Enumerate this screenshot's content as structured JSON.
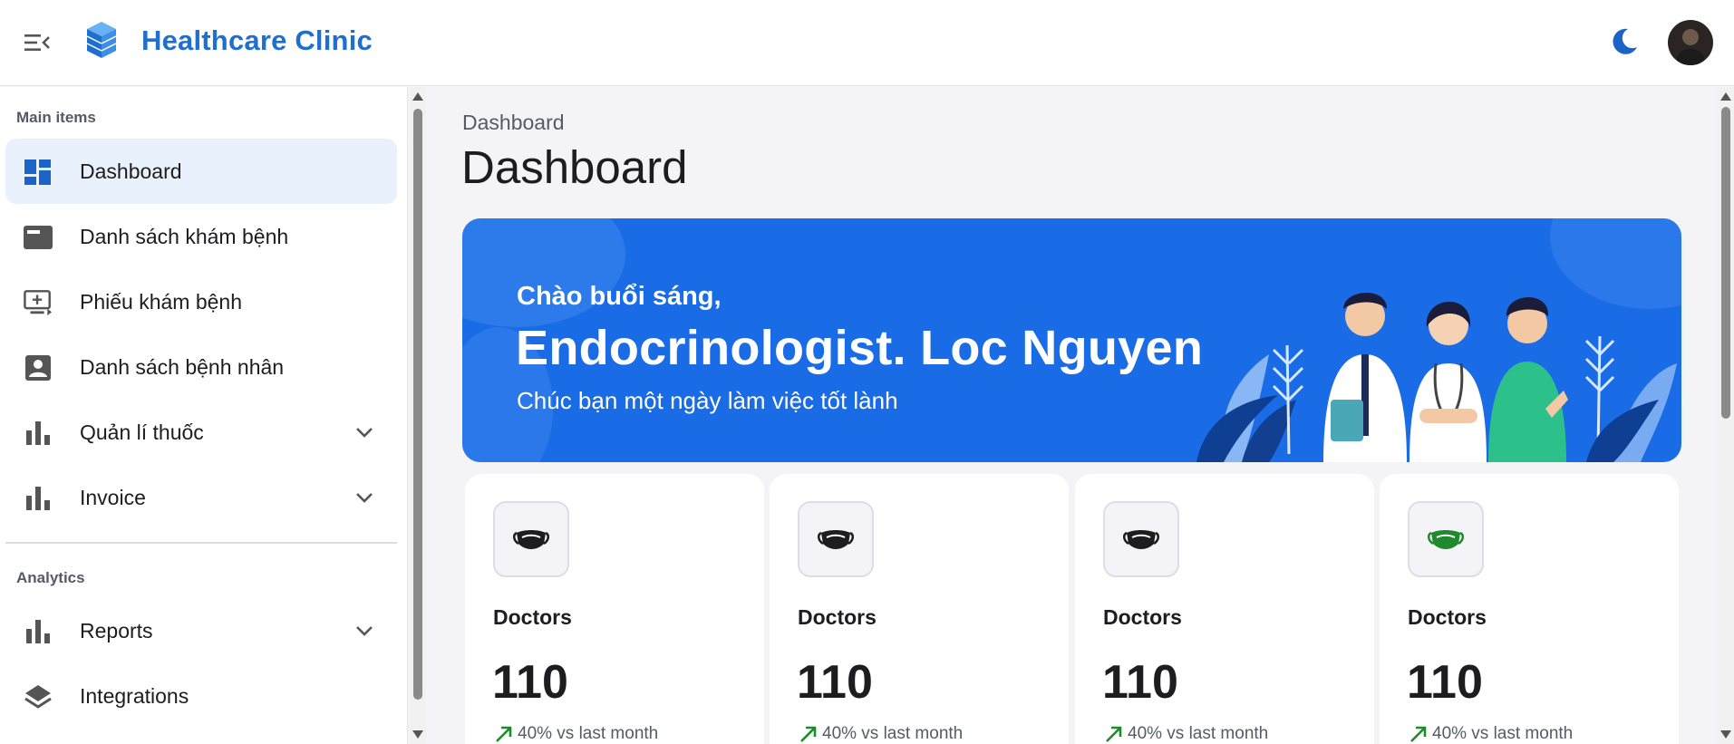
{
  "header": {
    "app_title": "Healthcare Clinic",
    "menu_icon": "menu-collapse-icon",
    "logo_icon": "cube-logo-icon",
    "theme_icon": "moon-icon",
    "accent_color": "#1f6fd1"
  },
  "sidebar": {
    "sections": [
      {
        "label": "Main items",
        "items": [
          {
            "label": "Dashboard",
            "icon": "dashboard-icon",
            "active": true
          },
          {
            "label": "Danh sách khám bệnh",
            "icon": "list-card-icon",
            "active": false
          },
          {
            "label": "Phiếu khám bệnh",
            "icon": "add-to-queue-icon",
            "active": false
          },
          {
            "label": "Danh sách bệnh nhân",
            "icon": "contact-icon",
            "active": false
          },
          {
            "label": "Quản lí thuốc",
            "icon": "bar-chart-icon",
            "active": false,
            "expandable": true
          },
          {
            "label": "Invoice",
            "icon": "bar-chart-icon",
            "active": false,
            "expandable": true
          }
        ]
      },
      {
        "label": "Analytics",
        "items": [
          {
            "label": "Reports",
            "icon": "bar-chart-icon",
            "active": false,
            "expandable": true
          },
          {
            "label": "Integrations",
            "icon": "layers-icon",
            "active": false
          }
        ]
      }
    ]
  },
  "main": {
    "breadcrumb": "Dashboard",
    "title": "Dashboard",
    "banner": {
      "greeting": "Chào buổi sáng,",
      "name": "Endocrinologist. Loc Nguyen",
      "wish": "Chúc bạn một ngày làm việc tốt lành",
      "background_color": "#1a6be6",
      "illustration": "doctors-illustration"
    },
    "stats": [
      {
        "label": "Doctors",
        "value": "110",
        "trend": "40% vs last month",
        "icon": "mask-icon",
        "icon_color": "#1d1d1f"
      },
      {
        "label": "Doctors",
        "value": "110",
        "trend": "40% vs last month",
        "icon": "mask-icon",
        "icon_color": "#1d1d1f"
      },
      {
        "label": "Doctors",
        "value": "110",
        "trend": "40% vs last month",
        "icon": "mask-icon",
        "icon_color": "#1d1d1f"
      },
      {
        "label": "Doctors",
        "value": "110",
        "trend": "40% vs last month",
        "icon": "mask-icon",
        "icon_color": "#1f8a2c"
      }
    ],
    "trend_color": "#1f8a2c"
  }
}
